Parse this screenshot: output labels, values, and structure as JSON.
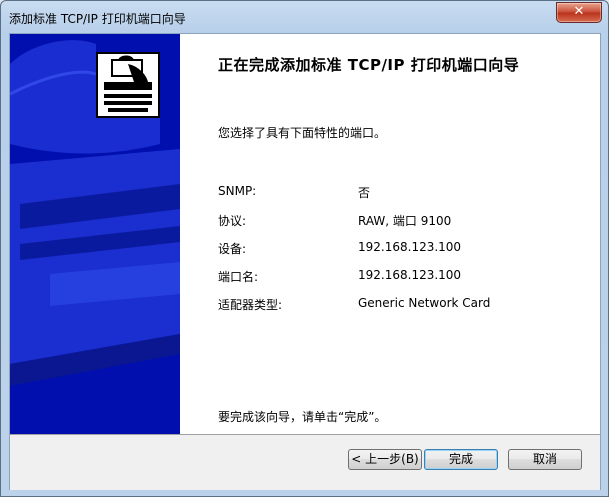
{
  "window": {
    "title": "添加标准 TCP/IP 打印机端口向导",
    "close_glyph": "✕"
  },
  "heading": "正在完成添加标准 TCP/IP 打印机端口向导",
  "intro": "您选择了具有下面特性的端口。",
  "properties": [
    {
      "label": "SNMP:",
      "value": "否"
    },
    {
      "label": "协议:",
      "value": "RAW, 端口 9100"
    },
    {
      "label": "设备:",
      "value": "192.168.123.100"
    },
    {
      "label": "端口名:",
      "value": "192.168.123.100"
    },
    {
      "label": "适配器类型:",
      "value": "Generic Network Card"
    }
  ],
  "finish_note": "要完成该向导，请单击“完成”。",
  "buttons": {
    "back": "< 上一步(B)",
    "finish": "完成",
    "cancel": "取消"
  },
  "colors": {
    "side_panel": "#000fae",
    "window_frame": "#b8d0ea"
  },
  "icons": {
    "side_logo": "printer-wizard-icon"
  }
}
